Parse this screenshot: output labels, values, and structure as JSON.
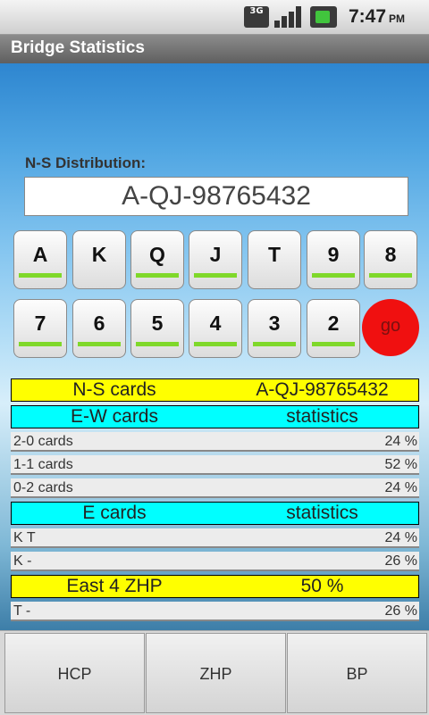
{
  "status_bar": {
    "time": "7:47",
    "am_pm": "PM",
    "network": "3G"
  },
  "app_title": "Bridge Statistics",
  "distribution": {
    "label": "N-S Distribution:",
    "value": "A-QJ-98765432"
  },
  "keys_row1": [
    {
      "label": "A",
      "selected": true
    },
    {
      "label": "K",
      "selected": false
    },
    {
      "label": "Q",
      "selected": true
    },
    {
      "label": "J",
      "selected": true
    },
    {
      "label": "T",
      "selected": false
    },
    {
      "label": "9",
      "selected": true
    },
    {
      "label": "8",
      "selected": true
    }
  ],
  "keys_row2": [
    {
      "label": "7",
      "selected": true
    },
    {
      "label": "6",
      "selected": true
    },
    {
      "label": "5",
      "selected": true
    },
    {
      "label": "4",
      "selected": true
    },
    {
      "label": "3",
      "selected": true
    },
    {
      "label": "2",
      "selected": true
    }
  ],
  "go_label": "go",
  "results": [
    {
      "type": "header",
      "color": "yellow",
      "left": "N-S cards",
      "right": "A-QJ-98765432"
    },
    {
      "type": "header",
      "color": "cyan",
      "left": "E-W cards",
      "right": "statistics"
    },
    {
      "type": "data",
      "left": "2-0 cards",
      "right": "24 %"
    },
    {
      "type": "data",
      "left": "1-1 cards",
      "right": "52 %"
    },
    {
      "type": "data",
      "left": "0-2 cards",
      "right": "24 %"
    },
    {
      "type": "header",
      "color": "cyan",
      "left": "E cards",
      "right": "statistics"
    },
    {
      "type": "data",
      "left": "K T",
      "right": "24 %"
    },
    {
      "type": "data",
      "left": "K -",
      "right": "26 %"
    },
    {
      "type": "header",
      "color": "yellow",
      "left": "East 4 ZHP",
      "right": "50 %"
    },
    {
      "type": "data",
      "left": "T -",
      "right": "26 %"
    }
  ],
  "tabs": [
    {
      "label": "HCP"
    },
    {
      "label": "ZHP"
    },
    {
      "label": "BP"
    }
  ],
  "colors": {
    "yellow": "#ffff00",
    "cyan": "#00ffff",
    "go": "#f01010",
    "key_bar": "#7fd82a"
  }
}
